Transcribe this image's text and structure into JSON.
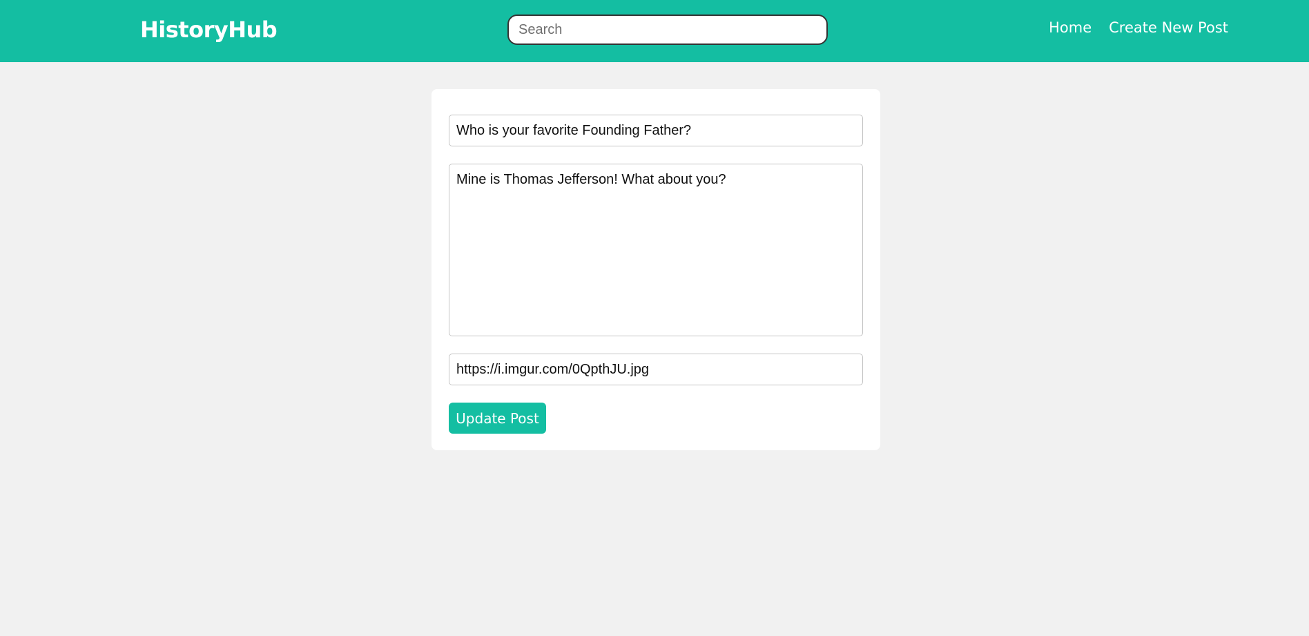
{
  "navbar": {
    "brand": "HistoryHub",
    "search": {
      "placeholder": "Search",
      "value": ""
    },
    "links": [
      {
        "label": "Home"
      },
      {
        "label": "Create New Post"
      }
    ]
  },
  "form": {
    "title_value": "Who is your favorite Founding Father?",
    "body_value": "Mine is Thomas Jefferson! What about you?",
    "image_url_value": "https://i.imgur.com/0QpthJU.jpg",
    "submit_label": "Update Post"
  },
  "colors": {
    "accent": "#14bea2",
    "background": "#f1f1f1",
    "card": "#ffffff"
  }
}
